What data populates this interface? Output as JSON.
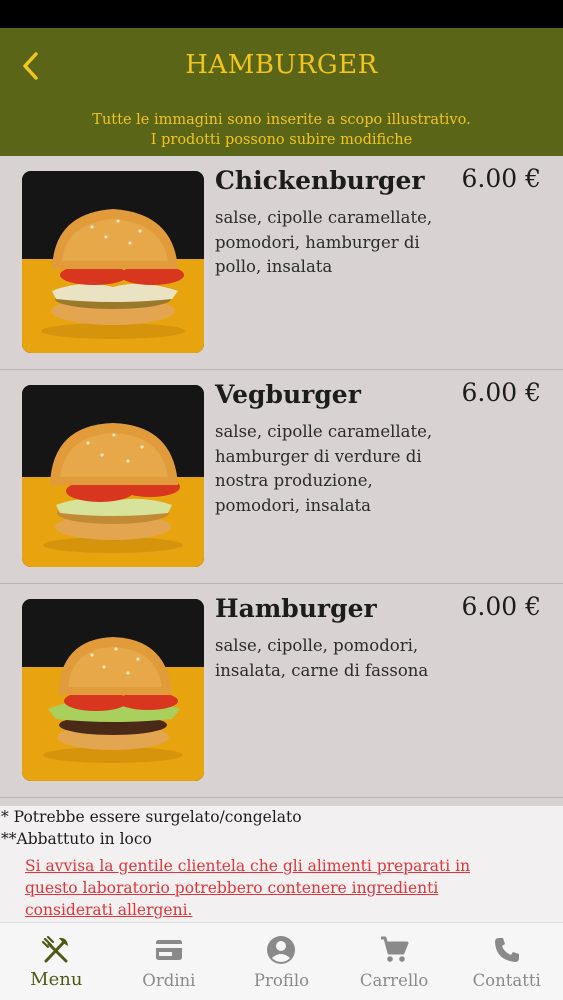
{
  "header": {
    "title": "HAMBURGER",
    "back_icon": "chevron-left-icon",
    "background_color": "#5a6518",
    "accent_color": "#f2c51c"
  },
  "notice": {
    "line1": "Tutte le immagini sono inserite a scopo illustrativo.",
    "line2": "I prodotti possono subire modifiche"
  },
  "products": [
    {
      "name": "Chickenburger",
      "price": "6.00 €",
      "description": "salse, cipolle caramellate, pomodori, hamburger di pollo, insalata"
    },
    {
      "name": "Vegburger",
      "price": "6.00 €",
      "description": "salse, cipolle caramellate, hamburger di verdure di nostra produzione, pomodori, insalata"
    },
    {
      "name": "Hamburger",
      "price": "6.00 €",
      "description": "salse, cipolle, pomodori, insalata, carne di fassona"
    }
  ],
  "footnotes": {
    "frozen": "* Potrebbe essere surgelato/congelato",
    "chilled": "**Abbattuto in loco",
    "allergen_warning": "Si avvisa la gentile clientela che gli alimenti preparati in questo laboratorio potrebbero contenere ingredienti considerati allergeni.",
    "warning_color": "#e0343a"
  },
  "bottom_nav": {
    "items": [
      {
        "label": "Menu",
        "icon": "fork-knife-icon",
        "active": true
      },
      {
        "label": "Ordini",
        "icon": "credit-card-icon",
        "active": false
      },
      {
        "label": "Profilo",
        "icon": "account-circle-icon",
        "active": false
      },
      {
        "label": "Carrello",
        "icon": "shopping-cart-icon",
        "active": false
      },
      {
        "label": "Contatti",
        "icon": "phone-icon",
        "active": false
      }
    ],
    "active_color": "#4e5a14",
    "inactive_color": "#8a8a8a"
  }
}
